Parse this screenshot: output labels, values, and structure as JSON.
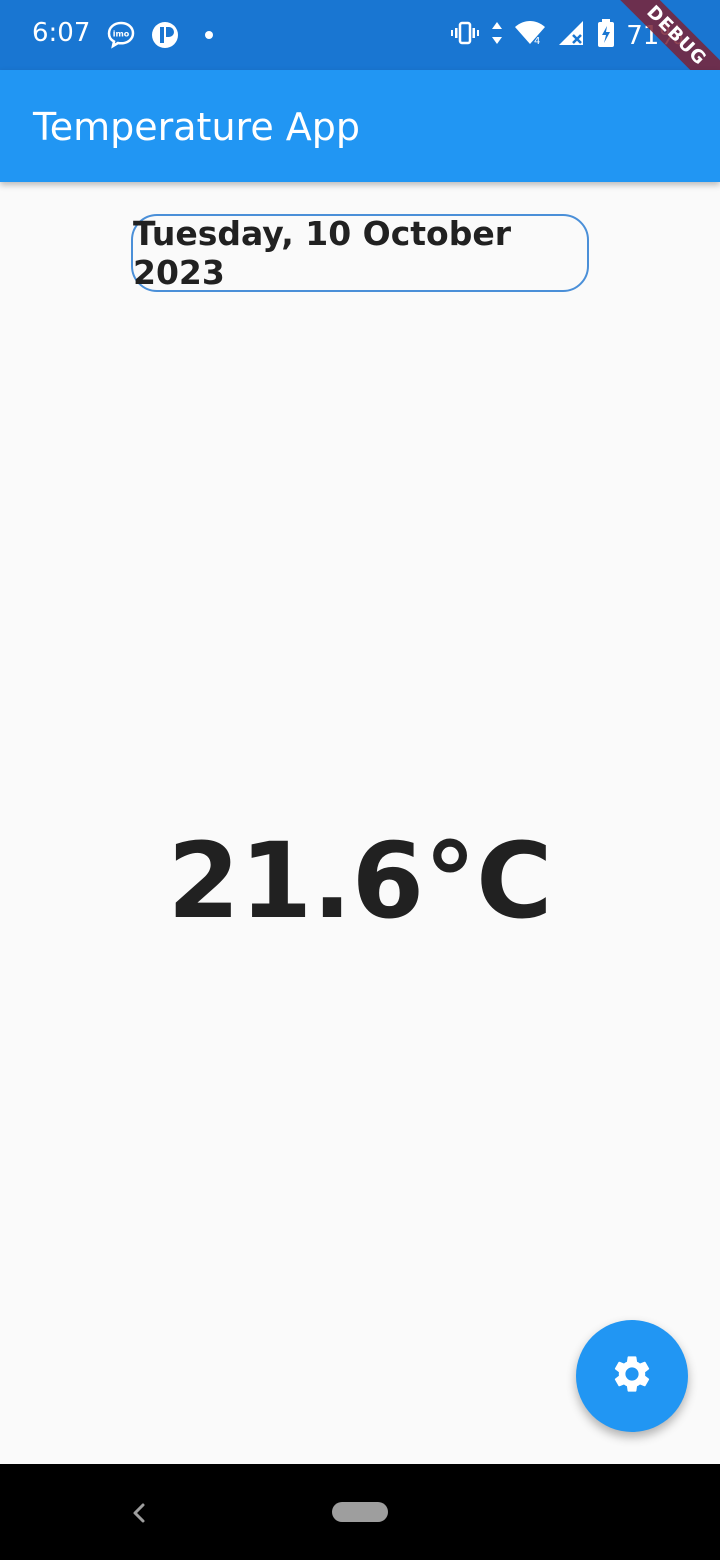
{
  "status_bar": {
    "time": "6:07",
    "battery_text": "71%",
    "debug_label": "DEBUG",
    "icons": [
      "imo-icon",
      "p-app-icon",
      "notification-dot-icon",
      "vibrate-icon",
      "data-arrows-icon",
      "wifi-icon",
      "signal-icon",
      "battery-charging-icon"
    ]
  },
  "app_bar": {
    "title": "Temperature App"
  },
  "main": {
    "date": "Tuesday, 10 October 2023",
    "temperature": "21.6°C"
  },
  "fab": {
    "icon": "gear-icon"
  },
  "nav_bar": {
    "icons": [
      "back-icon",
      "home-pill"
    ]
  },
  "colors": {
    "status_bar": "#1976d2",
    "app_bar": "#2196f3",
    "fab": "#2196f3",
    "chip_border": "#4a8fd8",
    "text": "#212121",
    "background": "#fafafa"
  }
}
